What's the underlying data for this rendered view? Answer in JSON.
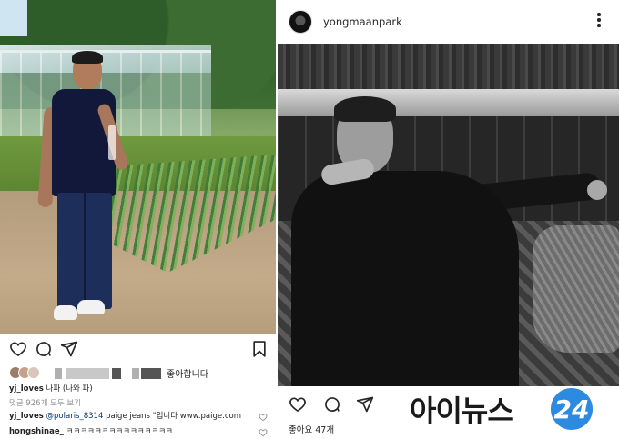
{
  "left_post": {
    "likes_by": "좋아합니다",
    "caption": {
      "username": "yj_loves",
      "text": "나파 (나와 파)"
    },
    "view_all_comments": "댓글 926개 모두 보기",
    "comments": [
      {
        "username": "yj_loves",
        "mention": "@polaris_8314",
        "text": "paige jeans \"입니다 www.paige.com"
      },
      {
        "username": "hongshinae_",
        "text": "ㅋㅋㅋㅋㅋㅋㅋㅋㅋㅋㅋㅋㅋㅋㅋ"
      }
    ]
  },
  "right_post": {
    "username": "yongmaanpark",
    "likes": "좋아요 47개"
  },
  "watermark": {
    "text": "아이뉴스",
    "number": "24",
    "accent_color": "#2c8be0"
  },
  "icons": {
    "like": "heart-icon",
    "comment": "comment-icon",
    "share": "share-icon",
    "save": "bookmark-icon",
    "more": "more-icon"
  }
}
